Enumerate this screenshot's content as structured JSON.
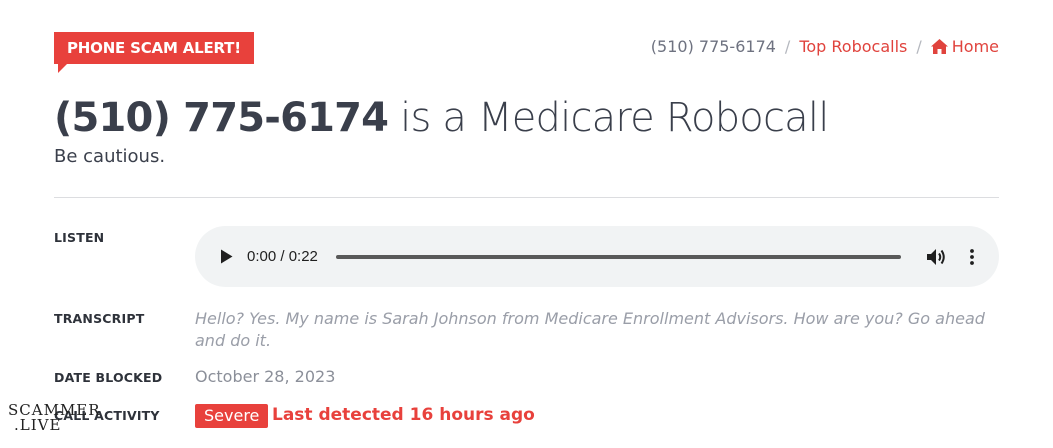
{
  "header": {
    "alert_label": "PHONE SCAM ALERT!",
    "breadcrumb": {
      "phone": "(510) 775-6174",
      "separator": "/",
      "top_robocalls": "Top Robocalls",
      "home": "Home"
    }
  },
  "main": {
    "title_number": "(510) 775-6174",
    "title_rest": " is a Medicare Robocall",
    "subtitle": "Be cautious."
  },
  "details": {
    "listen": {
      "label": "LISTEN",
      "time": "0:00 / 0:22"
    },
    "transcript": {
      "label": "TRANSCRIPT",
      "text": "Hello? Yes. My name is Sarah Johnson from Medicare Enrollment Advisors. How are you? Go ahead and do it."
    },
    "date_blocked": {
      "label": "DATE BLOCKED",
      "value": "October 28, 2023"
    },
    "call_activity": {
      "label": "CALL ACTIVITY",
      "severity": "Severe",
      "last_detected": "Last detected 16 hours ago"
    }
  },
  "watermark": {
    "line1": "SCAMMER",
    "line2": ".LIVE"
  },
  "colors": {
    "accent_red": "#e8413c",
    "text_dark": "#3a3f4b",
    "text_muted": "#9a9ea8"
  },
  "icons": [
    "home-icon",
    "play-icon",
    "volume-icon",
    "more-vertical-icon"
  ]
}
